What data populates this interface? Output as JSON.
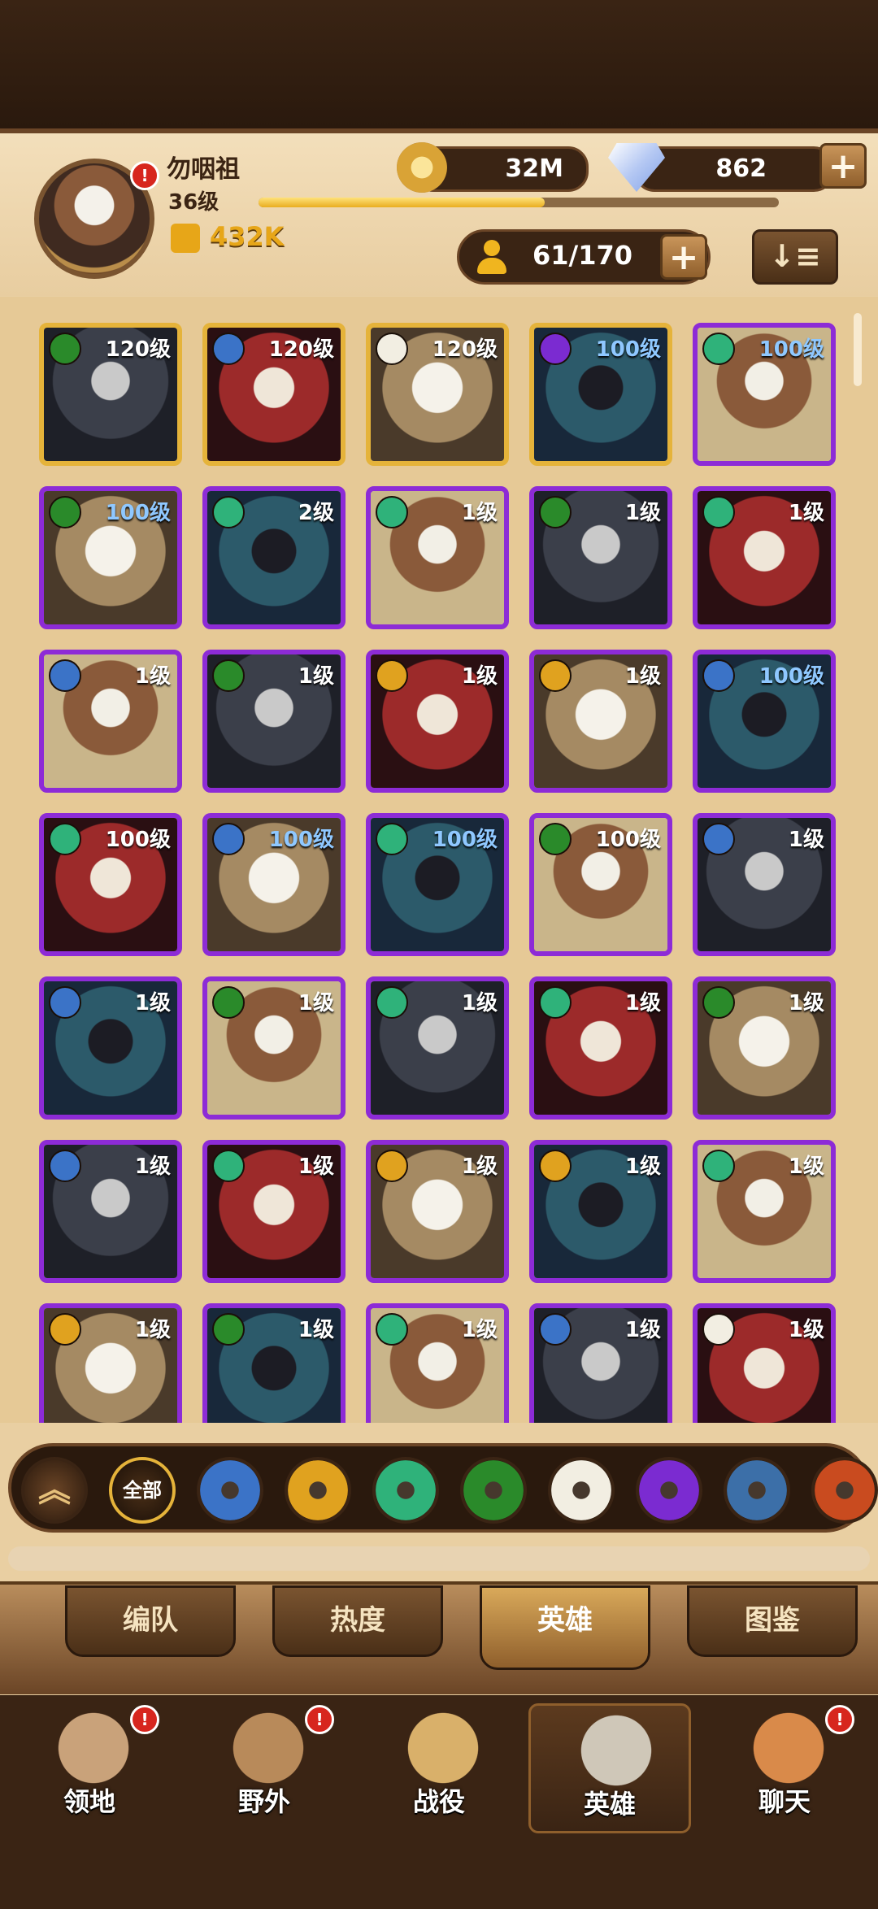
{
  "player": {
    "name": "勿咽祖",
    "level": "36级",
    "power": "432K",
    "xp_fraction": 0.55,
    "alert": "!"
  },
  "currency": {
    "gold": "32M",
    "gems": "862",
    "plus": "+"
  },
  "roster": {
    "count": "61/170",
    "plus": "+",
    "sort_icon": "↓≡"
  },
  "heroes": [
    {
      "level": "120级",
      "faction": "forest-eye",
      "frame": "gold",
      "blue": false
    },
    {
      "level": "120级",
      "faction": "celestial",
      "frame": "gold",
      "blue": false
    },
    {
      "level": "120级",
      "faction": "radiant",
      "frame": "gold",
      "blue": false
    },
    {
      "level": "100级",
      "faction": "void",
      "frame": "gold",
      "blue": true
    },
    {
      "level": "100级",
      "faction": "nature",
      "frame": "purple",
      "blue": true
    },
    {
      "level": "100级",
      "faction": "forest-eye",
      "frame": "purple",
      "blue": true
    },
    {
      "level": "2级",
      "faction": "nature",
      "frame": "purple",
      "blue": false
    },
    {
      "level": "1级",
      "faction": "nature",
      "frame": "purple",
      "blue": false
    },
    {
      "level": "1级",
      "faction": "forest-eye",
      "frame": "purple",
      "blue": false
    },
    {
      "level": "1级",
      "faction": "nature",
      "frame": "purple",
      "blue": false
    },
    {
      "level": "1级",
      "faction": "celestial",
      "frame": "purple",
      "blue": false
    },
    {
      "level": "1级",
      "faction": "forest-eye",
      "frame": "purple",
      "blue": false
    },
    {
      "level": "1级",
      "faction": "solar",
      "frame": "purple",
      "blue": false
    },
    {
      "level": "1级",
      "faction": "solar",
      "frame": "purple",
      "blue": false
    },
    {
      "level": "100级",
      "faction": "celestial",
      "frame": "purple",
      "blue": true
    },
    {
      "level": "100级",
      "faction": "nature",
      "frame": "purple",
      "blue": false
    },
    {
      "level": "100级",
      "faction": "celestial",
      "frame": "purple",
      "blue": true
    },
    {
      "level": "100级",
      "faction": "nature",
      "frame": "purple",
      "blue": true
    },
    {
      "level": "100级",
      "faction": "forest-eye",
      "frame": "purple",
      "blue": false
    },
    {
      "level": "1级",
      "faction": "celestial",
      "frame": "purple",
      "blue": false
    },
    {
      "level": "1级",
      "faction": "celestial",
      "frame": "purple",
      "blue": false
    },
    {
      "level": "1级",
      "faction": "forest-eye",
      "frame": "purple",
      "blue": false
    },
    {
      "level": "1级",
      "faction": "nature",
      "frame": "purple",
      "blue": false
    },
    {
      "level": "1级",
      "faction": "nature",
      "frame": "purple",
      "blue": false
    },
    {
      "level": "1级",
      "faction": "forest-eye",
      "frame": "purple",
      "blue": false
    },
    {
      "level": "1级",
      "faction": "celestial",
      "frame": "purple",
      "blue": false
    },
    {
      "level": "1级",
      "faction": "nature",
      "frame": "purple",
      "blue": false
    },
    {
      "level": "1级",
      "faction": "solar",
      "frame": "purple",
      "blue": false
    },
    {
      "level": "1级",
      "faction": "solar",
      "frame": "purple",
      "blue": false
    },
    {
      "level": "1级",
      "faction": "nature",
      "frame": "purple",
      "blue": false
    },
    {
      "level": "1级",
      "faction": "solar",
      "frame": "purple",
      "blue": false
    },
    {
      "level": "1级",
      "faction": "forest-eye",
      "frame": "purple",
      "blue": false
    },
    {
      "level": "1级",
      "faction": "nature",
      "frame": "purple",
      "blue": false
    },
    {
      "level": "1级",
      "faction": "celestial",
      "frame": "purple",
      "blue": false
    },
    {
      "level": "1级",
      "faction": "radiant",
      "frame": "purple",
      "blue": false
    }
  ],
  "filters": {
    "collapse_icon": "︽",
    "all_label": "全部",
    "faction_icons": [
      "celestial",
      "solar",
      "nature",
      "forest-eye",
      "radiant",
      "void",
      "arcane",
      "flame"
    ]
  },
  "tabs": [
    "编队",
    "热度",
    "英雄",
    "图鉴"
  ],
  "active_tab": "英雄",
  "nav": [
    {
      "label": "领地",
      "icon": "castle-icon",
      "alert": true
    },
    {
      "label": "野外",
      "icon": "scroll-map-icon",
      "alert": true
    },
    {
      "label": "战役",
      "icon": "battle-sword-icon",
      "alert": false
    },
    {
      "label": "英雄",
      "icon": "knight-helmet-icon",
      "alert": false,
      "active": true
    },
    {
      "label": "聊天",
      "icon": "chat-bubble-icon",
      "alert": true
    }
  ],
  "colors": {
    "frame_gold": "#e5b33a",
    "frame_purple": "#8d2bd6",
    "celestial": "#3b73c7",
    "solar": "#e0a21f",
    "nature": "#2fb27a",
    "forest-eye": "#2a8a2a",
    "radiant": "#f2eee2",
    "void": "#7b2bd1",
    "arcane": "#3c6fa8",
    "flame": "#c94b1f"
  }
}
